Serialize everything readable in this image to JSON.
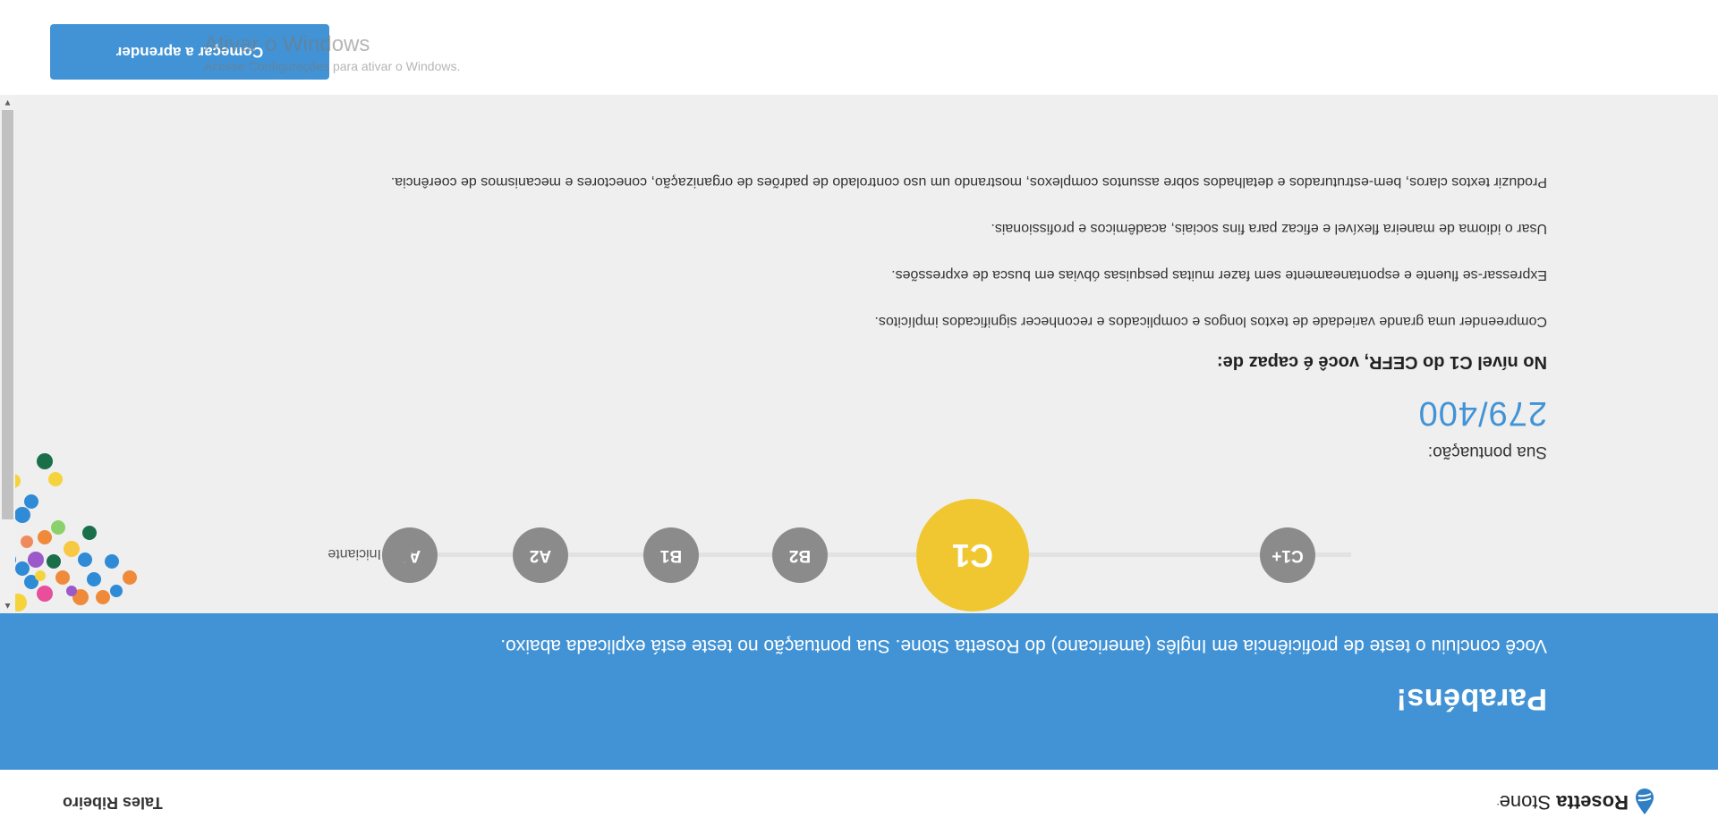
{
  "header": {
    "logo_bold": "Rosetta",
    "logo_regular": "Stone",
    "logo_mark": ".",
    "user_name": "Tales Ribeiro"
  },
  "banner": {
    "title": "Parabéns!",
    "text": "Você concluiu o teste de proficiência em Inglês (americano) do Rosetta Stone. Sua pontuação no teste está explicada abaixo."
  },
  "levels": {
    "start_label": "Iniciante",
    "items": [
      {
        "label": "A1",
        "current": false
      },
      {
        "label": "A2",
        "current": false
      },
      {
        "label": "B1",
        "current": false
      },
      {
        "label": "B2",
        "current": false
      },
      {
        "label": "C1",
        "current": true
      },
      {
        "label": "C1+",
        "current": false
      }
    ]
  },
  "score": {
    "label": "Sua pontuação:",
    "value": "279/400",
    "achieved": 279,
    "max": 400
  },
  "abilities": {
    "title": "No nível C1 do CEFR, você é capaz de:",
    "items": [
      "Compreender uma grande variedade de textos longos e complicados e reconhecer significados implícitos.",
      "Expressar-se fluente e espontaneamente sem fazer muitas pesquisas óbvias em busca de expressões.",
      "Usar o idioma de maneira flexível e eficaz para fins sociais, acadêmicos e profissionais.",
      "Produzir textos claros, bem-estruturados e detalhados sobre assuntos complexos, mostrando um uso controlado de padrões de organização, conectores e mecanismos de coerência."
    ]
  },
  "footer": {
    "start_button": "Começar a aprender"
  },
  "watermark": {
    "title": "Ativar o Windows",
    "subtitle": "Acesse Configurações para ativar o Windows."
  },
  "colors": {
    "brand_blue": "#4293d5",
    "level_gray": "#8b8b8b",
    "current_level_yellow": "#f0c731",
    "main_bg": "#efefef"
  }
}
